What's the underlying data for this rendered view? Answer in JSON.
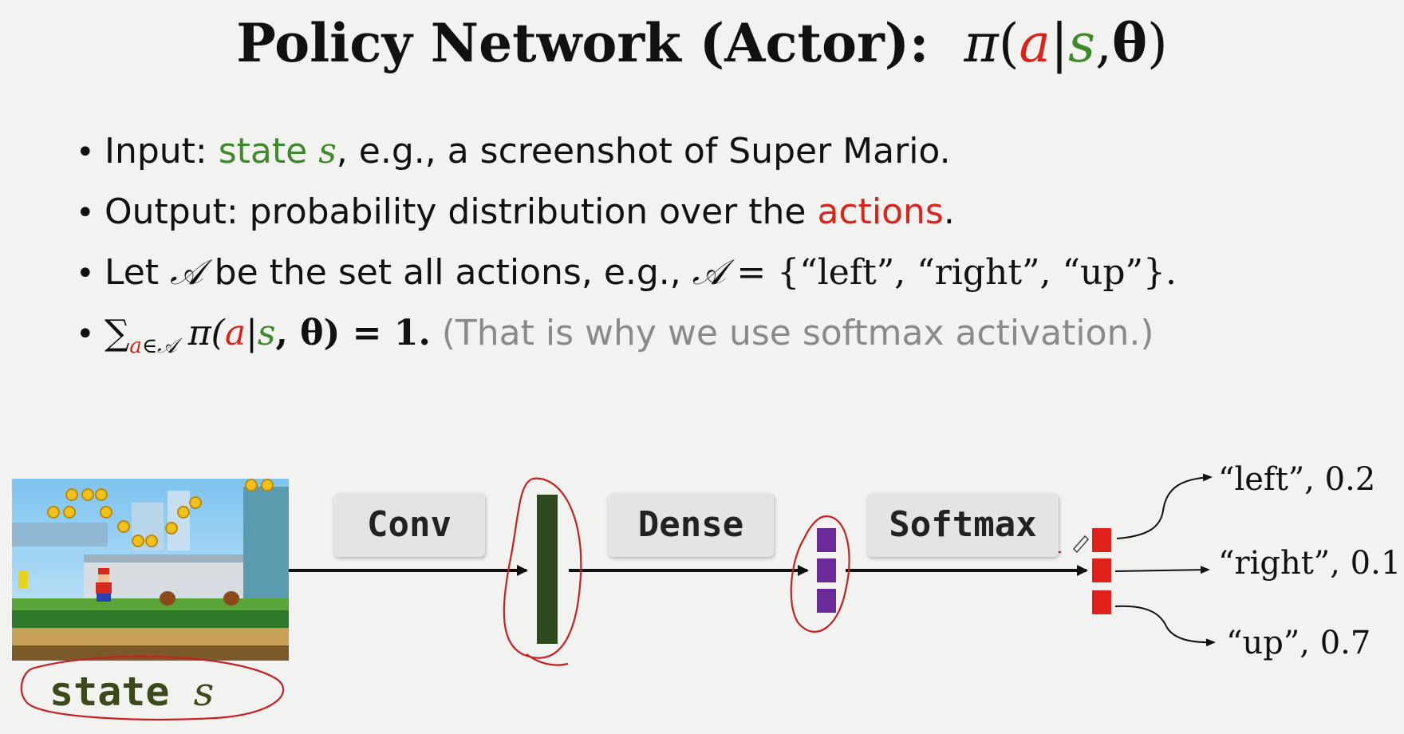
{
  "title": {
    "text": "Policy Network (Actor):",
    "pi": "π",
    "a": "a",
    "bar": "|",
    "s": "s",
    "comma": ",",
    "theta": "θ",
    "open": "(",
    "close": ")"
  },
  "bullets": {
    "b1": {
      "pre": "Input: ",
      "hl": "state ",
      "s": "s",
      "post": ", e.g., a screenshot of Super Mario."
    },
    "b2": {
      "pre": "Output: probability distribution over the ",
      "hl": "actions",
      "post": "."
    },
    "b3": {
      "pre": "Let ",
      "A": "𝒜",
      "mid": " be the set all actions, e.g., ",
      "A2": "𝒜",
      "eq": " = {“left”, “right”, “up”}."
    },
    "b4": {
      "sum": "∑",
      "sub_a": "a",
      "sub_in": "∈𝒜",
      "pi": " π(",
      "a": "a",
      "bar": "|",
      "s": "s",
      "theta_part": ", θ) = 1.",
      "note": " (That is why we use softmax activation.)"
    }
  },
  "diagram": {
    "conv_label": "Conv",
    "dense_label": "Dense",
    "softmax_label": "Softmax",
    "state_word": "state",
    "state_sym": "s",
    "outputs": [
      {
        "action": "“left”, 0.2",
        "prob": 0.2
      },
      {
        "action": "“right”, 0.1",
        "prob": 0.1
      },
      {
        "action": "“up”, 0.7",
        "prob": 0.7
      }
    ]
  },
  "colors": {
    "state": "#3e8a2a",
    "action": "#d9241c",
    "conv_vec": "#2f4a1f",
    "dense_vec": "#6a2a9a",
    "softmax_vec": "#e0201a"
  }
}
